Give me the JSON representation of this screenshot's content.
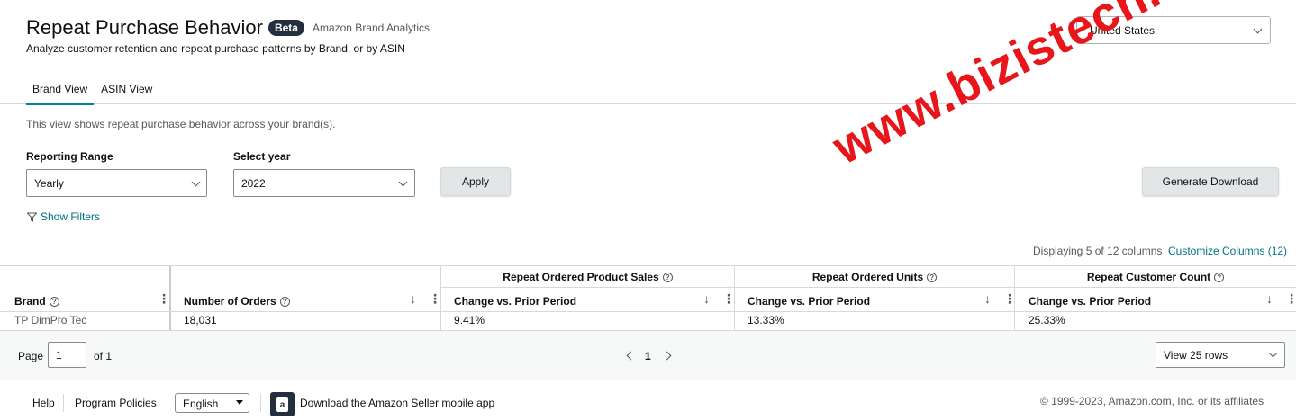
{
  "header": {
    "title": "Repeat Purchase Behavior",
    "beta": "Beta",
    "brand_analytics": "Amazon Brand Analytics",
    "subtitle": "Analyze customer retention and repeat purchase patterns by Brand, or by ASIN",
    "marketplace": "United States"
  },
  "tabs": [
    {
      "label": "Brand View",
      "active": true
    },
    {
      "label": "ASIN View",
      "active": false
    }
  ],
  "info_text": "This view shows repeat purchase behavior across your brand(s).",
  "filters": {
    "reporting_range_label": "Reporting Range",
    "reporting_range_value": "Yearly",
    "year_label": "Select year",
    "year_value": "2022",
    "apply": "Apply",
    "generate_download": "Generate Download",
    "show_filters": "Show Filters"
  },
  "columns_info": {
    "displaying": "Displaying 5 of 12 columns",
    "customize": "Customize Columns (12)"
  },
  "table": {
    "groups": [
      "Repeat Ordered Product Sales",
      "Repeat Ordered Units",
      "Repeat Customer Count"
    ],
    "headers": [
      "Brand",
      "Number of Orders",
      "Change vs. Prior Period",
      "Change vs. Prior Period",
      "Change vs. Prior Period"
    ],
    "row": [
      "TP DimPro Tec",
      "18,031",
      "9.41%",
      "13.33%",
      "25.33%"
    ]
  },
  "pager": {
    "page_label": "Page",
    "page_value": "1",
    "of_label": "of 1",
    "current": "1",
    "rows": "View 25 rows"
  },
  "footer": {
    "help": "Help",
    "policies": "Program Policies",
    "language": "English",
    "app": "Download the Amazon Seller mobile app",
    "copyright": "© 1999-2023, Amazon.com, Inc. or its affiliates"
  },
  "watermark": "www.bizistech.cn",
  "colors": {
    "accent": "#008296",
    "link": "#007185",
    "watermark": "#e8151b"
  }
}
